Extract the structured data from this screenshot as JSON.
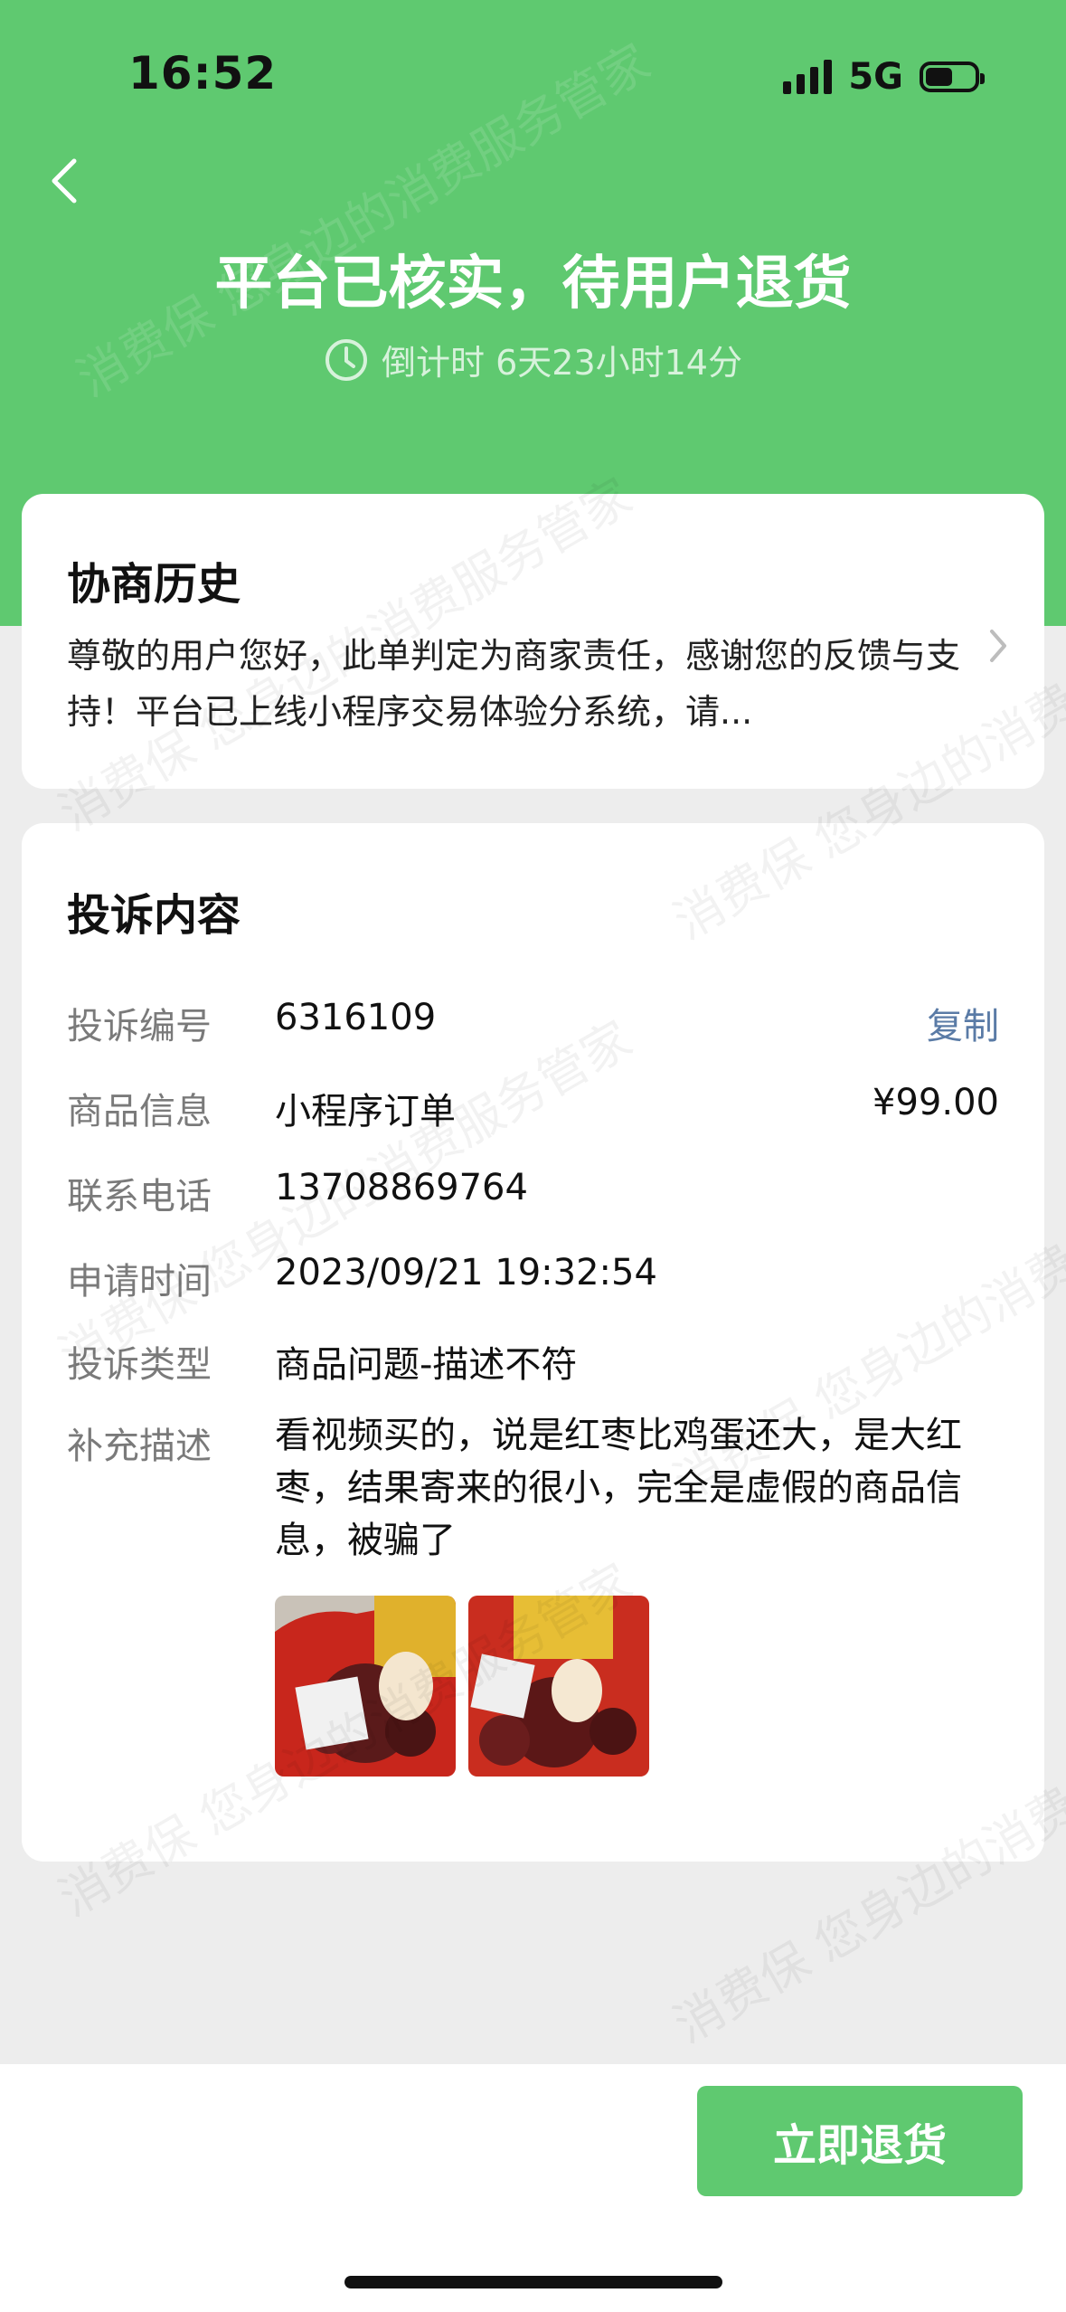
{
  "status_bar": {
    "time": "16:52",
    "network": "5G"
  },
  "header": {
    "title": "平台已核实，待用户退货",
    "countdown": "倒计时 6天23小时14分"
  },
  "history": {
    "title": "协商历史",
    "text": "尊敬的用户您好，此单判定为商家责任，感谢您的反馈与支持！平台已上线小程序交易体验分系统，请..."
  },
  "complaint": {
    "title": "投诉内容",
    "rows": {
      "id": {
        "label": "投诉编号",
        "value": "6316109",
        "action": "复制"
      },
      "product": {
        "label": "商品信息",
        "value": "小程序订单",
        "price": "¥99.00"
      },
      "phone": {
        "label": "联系电话",
        "value": "13708869764"
      },
      "time": {
        "label": "申请时间",
        "value": "2023/09/21 19:32:54"
      },
      "type": {
        "label": "投诉类型",
        "value": "商品问题-描述不符"
      },
      "desc": {
        "label": "补充描述",
        "value": "看视频买的，说是红枣比鸡蛋还大，是大红枣，结果寄来的很小，完全是虚假的商品信息，被骗了"
      }
    }
  },
  "footer": {
    "button": "立即退货"
  },
  "watermark": {
    "text_a": "消费保 您身边的消费服务管家",
    "text_b": "消费保 您身边的消费服务管家"
  },
  "colors": {
    "brand_green": "#5fc970",
    "link_blue": "#5a7ba6"
  }
}
